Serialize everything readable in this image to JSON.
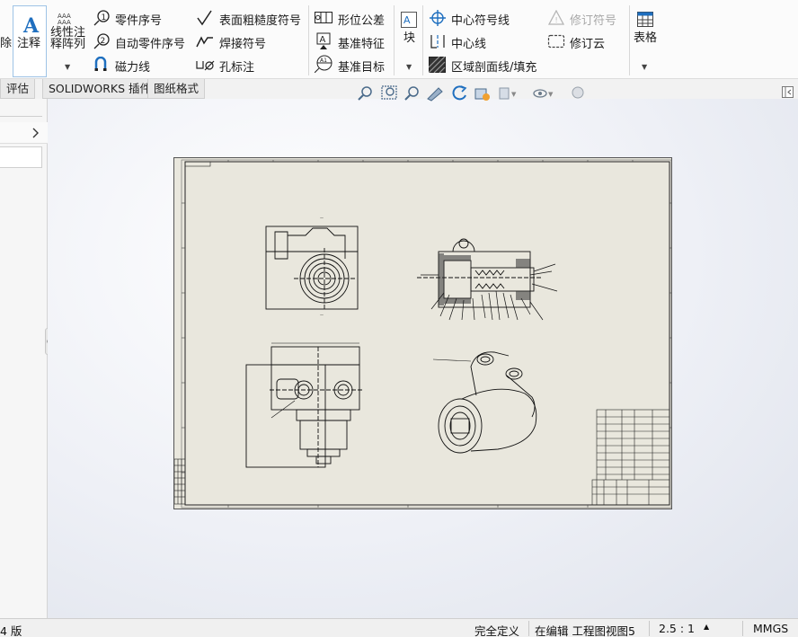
{
  "ribbon": {
    "clipped_left_label": "除",
    "annotation_label": "注释",
    "linear_note_pattern_label": "线性注\n释阵列",
    "balloon_label": "零件序号",
    "auto_balloon_label": "自动零件序号",
    "magnetic_line_label": "磁力线",
    "surface_finish_label": "表面粗糙度符号",
    "weld_symbol_label": "焊接符号",
    "hole_callout_label": "孔标注",
    "geometric_tolerance_label": "形位公差",
    "datum_feature_label": "基准特征",
    "datum_target_label": "基准目标",
    "blocks_label": "块",
    "center_mark_label": "中心符号线",
    "centerline_label": "中心线",
    "area_hatch_label": "区域剖面线/填充",
    "revision_symbol_label": "修订符号",
    "revision_cloud_label": "修订云",
    "tables_label": "表格"
  },
  "tabs": {
    "evaluate": "评估",
    "solidworks_addins": "SOLIDWORKS 插件",
    "sheet_format": "图纸格式"
  },
  "status": {
    "left_text": "4 版",
    "fully_defined": "完全定义",
    "editing": "在编辑 工程图视图5",
    "scale": "2.5 : 1",
    "scale_caret": "▲",
    "units": "MMGS"
  },
  "colors": {
    "ribbon_bg": "#fbfbfb",
    "accent_blue": "#1f6fbf",
    "sheet_bg": "#e9e7dd",
    "canvas_bg": "#e6e9f0"
  },
  "icons": [
    "annotation-icon",
    "balloon-icon",
    "surface-finish-icon",
    "geometric-tolerance-icon",
    "center-mark-icon",
    "revision-symbol-icon",
    "table-icon",
    "zoom-to-fit-icon",
    "rotate-icon",
    "view-orientation-icon",
    "hide-show-icon",
    "appearance-icon"
  ]
}
